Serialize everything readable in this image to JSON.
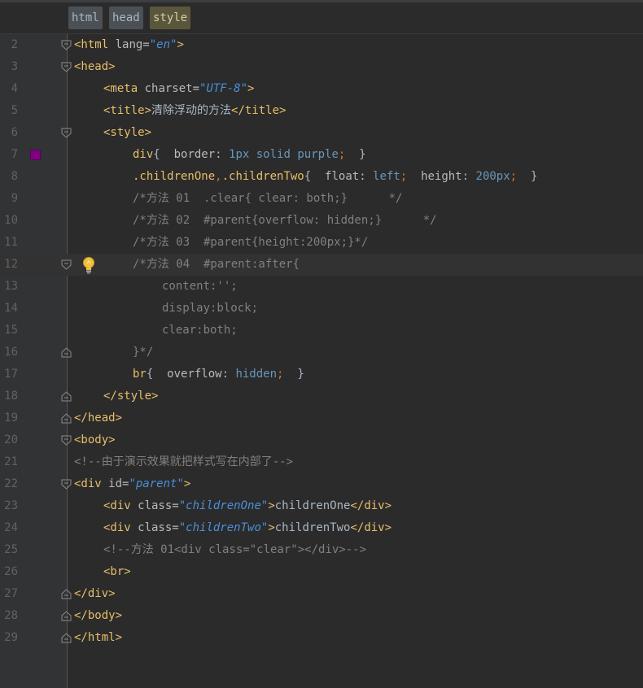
{
  "breadcrumbs": [
    {
      "label": "html",
      "active": false
    },
    {
      "label": "head",
      "active": false
    },
    {
      "label": "style",
      "active": true
    }
  ],
  "gutter": {
    "line_numbers": [
      "2",
      "3",
      "4",
      "5",
      "6",
      "7",
      "8",
      "9",
      "10",
      "11",
      "12",
      "13",
      "14",
      "15",
      "16",
      "17",
      "18",
      "19",
      "20",
      "21",
      "22",
      "23",
      "24",
      "25",
      "26",
      "27",
      "28",
      "29"
    ],
    "color_swatch": "#800080"
  },
  "code": {
    "l2": {
      "open": "<html",
      "attr": " lang=",
      "val": "\"en\"",
      "close": ">"
    },
    "l3": {
      "tag": "<head>"
    },
    "l4": {
      "open": "<meta",
      "attr": " charset=",
      "val": "\"UTF-8\"",
      "close": ">"
    },
    "l5": {
      "open": "<title>",
      "text": "清除浮动的方法",
      "close": "</title>"
    },
    "l6": {
      "tag": "<style>"
    },
    "l7": {
      "sel": "div",
      "brace_open": "{",
      "prop": "  border",
      "colon": ": ",
      "val": "1px solid purple",
      "semi": ";",
      "brace_close": "  }"
    },
    "l8": {
      "sel1": ".childrenOne",
      "comma": ",",
      "sel2": ".childrenTwo",
      "brace_open": "{",
      "prop1": "  float",
      "colon1": ": ",
      "val1": "left",
      "semi1": ";",
      "prop2": "  height",
      "colon2": ": ",
      "val2": "200px",
      "semi2": ";",
      "brace_close": "  }"
    },
    "l9": "/*方法 01  .clear{ clear: both;}      */",
    "l10": "/*方法 02  #parent{overflow: hidden;}      */",
    "l11": "/*方法 03  #parent{height:200px;}*/",
    "l12": "/*方法 04  #parent:after{",
    "l13": "content:'';",
    "l14": "display:block;",
    "l15": "clear:both;",
    "l16": "}*/",
    "l17": {
      "sel": "br",
      "brace_open": "{",
      "prop": "  overflow",
      "colon": ": ",
      "val": "hidden",
      "semi": ";",
      "brace_close": "  }"
    },
    "l18": {
      "tag": "</style>"
    },
    "l19": {
      "tag": "</head>"
    },
    "l20": {
      "tag": "<body>"
    },
    "l21": "<!--由于演示效果就把样式写在内部了-->",
    "l22": {
      "open": "<div",
      "attr": " id=",
      "val": "\"parent\"",
      "close": ">"
    },
    "l23": {
      "open": "<div",
      "attr": " class=",
      "val": "\"childrenOne\"",
      "close": ">",
      "text": "childrenOne",
      "end": "</div>"
    },
    "l24": {
      "open": "<div",
      "attr": " class=",
      "val": "\"childrenTwo\"",
      "close": ">",
      "text": "childrenTwo",
      "end": "</div>"
    },
    "l25": "<!--方法 01<div class=\"clear\"></div>-->",
    "l26": {
      "tag": "<br>"
    },
    "l27": {
      "tag": "</div>"
    },
    "l28": {
      "tag": "</body>"
    },
    "l29": {
      "tag": "</html>"
    }
  }
}
